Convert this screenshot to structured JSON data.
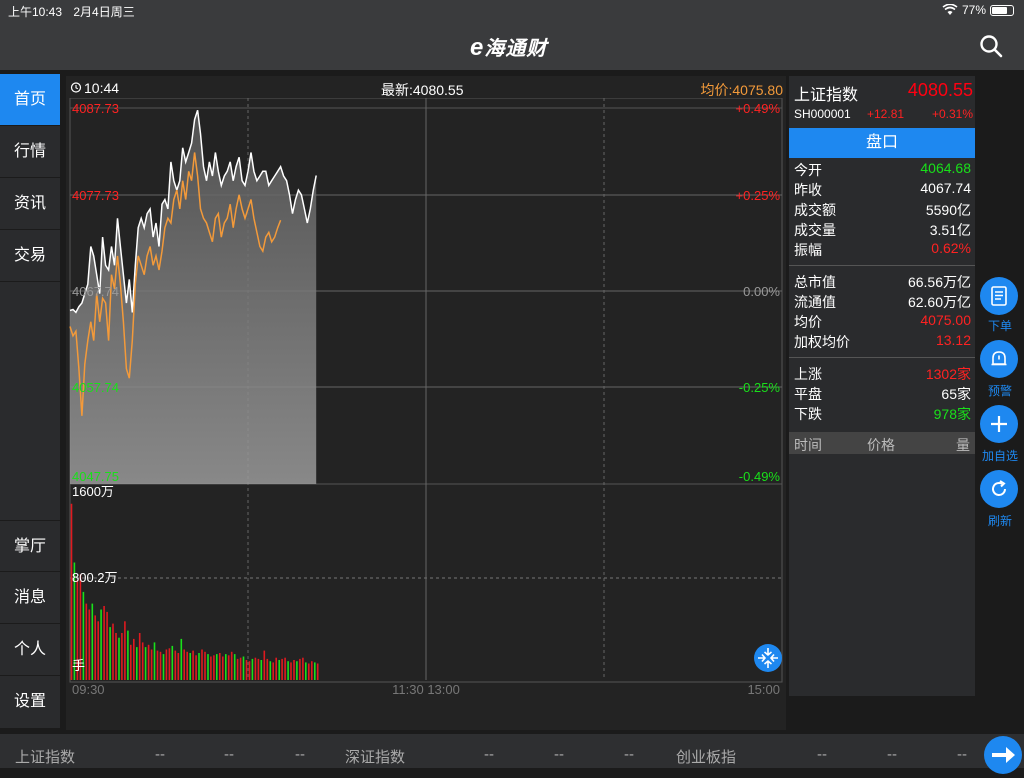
{
  "status": {
    "time": "上午10:43",
    "date": "2月4日周三",
    "battery": "77%",
    "battery_level": 0.77
  },
  "header": {
    "logo_e": "e",
    "logo_text": "海通财"
  },
  "sidebar": {
    "top_items": [
      {
        "label": "首页"
      },
      {
        "label": "行情"
      },
      {
        "label": "资讯"
      },
      {
        "label": "交易"
      }
    ],
    "bottom_items": [
      {
        "label": "掌厅"
      },
      {
        "label": "消息"
      },
      {
        "label": "个人"
      },
      {
        "label": "设置"
      }
    ]
  },
  "chart_top": {
    "time": "10:44",
    "latest_label": "最新:4080.55",
    "avg_label": "均价:4075.80"
  },
  "chart_data": {
    "type": "line",
    "title": "",
    "price_ticks": [
      "4087.73",
      "4077.73",
      "4067.74",
      "4057.74",
      "4047.75"
    ],
    "pct_ticks": [
      "+0.49%",
      "+0.25%",
      "0.00%",
      "-0.25%",
      "-0.49%"
    ],
    "x_ticks": [
      "09:30",
      "11:30 13:00",
      "15:00"
    ],
    "volume_ticks": [
      "1600万",
      "800.2万",
      "手"
    ],
    "ylim": [
      4047.75,
      4087.73
    ],
    "prev_close": 4067.74,
    "series": [
      {
        "color": "#ffffff",
        "values": [
          4066.2,
          4066.3,
          4066.0,
          4066.6,
          4067.0,
          4068.0,
          4069.0,
          4073.0,
          4072.0,
          4070.0,
          4068.0,
          4074.0,
          4071.0,
          4070.5,
          4073.0,
          4071.0,
          4076.0,
          4073.0,
          4070.0,
          4067.0,
          4069.5,
          4066.0,
          4071.0,
          4075.0,
          4076.0,
          4075.0,
          4076.5,
          4077.0,
          4074.0,
          4075.5,
          4073.0,
          4077.5,
          4078.0,
          4077.0,
          4082.0,
          4080.0,
          4079.0,
          4080.0,
          4083.5,
          4082.0,
          4083.0,
          4084.0,
          4086.5,
          4087.5,
          4085.0,
          4081.5,
          4080.0,
          4082.0,
          4080.5,
          4083.0,
          4081.0,
          4079.5,
          4080.5,
          4081.0,
          4082.0,
          4080.0,
          4081.5,
          4082.5,
          4080.0,
          4079.5,
          4081.0,
          4083.0,
          4081.0,
          4080.0,
          4080.5,
          4081.0,
          4081.0,
          4079.5,
          4080.0,
          4080.5,
          4081.0,
          4081.5,
          4080.5,
          4080.0,
          4078.5,
          4076.5,
          4078.0,
          4079.0,
          4078.5,
          4077.0,
          4075.5,
          4077.0,
          4079.0,
          4080.55
        ]
      },
      {
        "color": "#f39a3a",
        "values": [
          4064.5,
          4063.5,
          4064.0,
          4060.0,
          4055.0,
          4060.5,
          4063.0,
          4065.0,
          4063.0,
          4068.0,
          4065.0,
          4067.5,
          4067.0,
          4063.0,
          4070.0,
          4068.5,
          4072.0,
          4069.0,
          4065.0,
          4060.0,
          4059.0,
          4063.0,
          4069.0,
          4072.0,
          4071.0,
          4070.0,
          4072.0,
          4073.0,
          4071.0,
          4072.0,
          4070.5,
          4072.5,
          4075.0,
          4076.0,
          4075.5,
          4078.0,
          4079.0,
          4077.0,
          4080.0,
          4078.0,
          4081.0,
          4080.0,
          4083.0,
          4080.5,
          4077.0,
          4076.0,
          4075.5,
          4074.5,
          4073.5,
          4076.0,
          4076.5,
          4074.0,
          4075.5,
          4076.0,
          4077.5,
          4075.0,
          4077.0,
          4078.5,
          4077.0,
          4076.0,
          4077.0,
          4078.0,
          4076.0,
          4074.5,
          4073.0,
          4072.5,
          4074.0,
          4074.5,
          4073.5,
          4074.0,
          4075.0,
          4075.8
        ]
      }
    ],
    "volume": {
      "max": 16000000,
      "bars": [
        15.0,
        10.0,
        8.5,
        9.0,
        7.5,
        6.5,
        6.0,
        6.5,
        5.5,
        5.0,
        6.0,
        6.3,
        5.8,
        4.5,
        4.8,
        4.0,
        3.6,
        4.0,
        5.0,
        4.2,
        3.0,
        3.5,
        2.8,
        4.0,
        3.2,
        2.8,
        3.0,
        2.6,
        3.2,
        2.5,
        2.4,
        2.2,
        2.6,
        2.7,
        2.9,
        2.5,
        2.3,
        3.5,
        2.6,
        2.4,
        2.3,
        2.5,
        2.1,
        2.3,
        2.6,
        2.4,
        2.2,
        2.0,
        2.1,
        2.2,
        2.3,
        2.0,
        2.2,
        2.1,
        2.4,
        2.2,
        1.8,
        1.9,
        2.0,
        1.7,
        1.6,
        1.8,
        1.9,
        1.8,
        1.7,
        2.5,
        1.8,
        1.6,
        1.5,
        1.9,
        1.7,
        1.8,
        1.9,
        1.6,
        1.5,
        1.7,
        1.6,
        1.8,
        1.9,
        1.5,
        1.4,
        1.6,
        1.5,
        1.4
      ]
    }
  },
  "right_panel": {
    "name": "上证指数",
    "price": "4080.55",
    "code": "SH000001",
    "chg": "+12.81",
    "chg_pct": "+0.31%",
    "tab": "盘口",
    "rows1": [
      {
        "k": "今开",
        "v": "4064.68",
        "color": "green"
      },
      {
        "k": "昨收",
        "v": "4067.74",
        "color": "white"
      },
      {
        "k": "成交额",
        "v": "5590亿",
        "color": "white"
      },
      {
        "k": "成交量",
        "v": "3.51亿",
        "color": "white"
      },
      {
        "k": "振幅",
        "v": "0.62%",
        "color": "red"
      }
    ],
    "rows2": [
      {
        "k": "总市值",
        "v": "66.56万亿",
        "color": "white"
      },
      {
        "k": "流通值",
        "v": "62.60万亿",
        "color": "white"
      },
      {
        "k": "均价",
        "v": "4075.00",
        "color": "red"
      },
      {
        "k": "加权均价",
        "v": "13.12",
        "color": "red"
      }
    ],
    "rows3": [
      {
        "k": "上涨",
        "v": "1302家",
        "color": "red"
      },
      {
        "k": "平盘",
        "v": "65家",
        "color": "white"
      },
      {
        "k": "下跌",
        "v": "978家",
        "color": "green"
      }
    ],
    "trade_head": {
      "time": "时间",
      "price": "价格",
      "qty": "量"
    }
  },
  "float_buttons": [
    {
      "label": "下单",
      "icon": "document-icon"
    },
    {
      "label": "预警",
      "icon": "bell-icon"
    },
    {
      "label": "加自选",
      "icon": "plus-icon"
    },
    {
      "label": "刷新",
      "icon": "refresh-icon"
    }
  ],
  "bottom_bar": {
    "items": [
      {
        "name": "上证指数",
        "a": "--",
        "b": "--",
        "c": "--"
      },
      {
        "name": "深证指数",
        "a": "--",
        "b": "--",
        "c": "--"
      },
      {
        "name": "创业板指",
        "a": "--",
        "b": "--",
        "c": "--"
      }
    ]
  }
}
